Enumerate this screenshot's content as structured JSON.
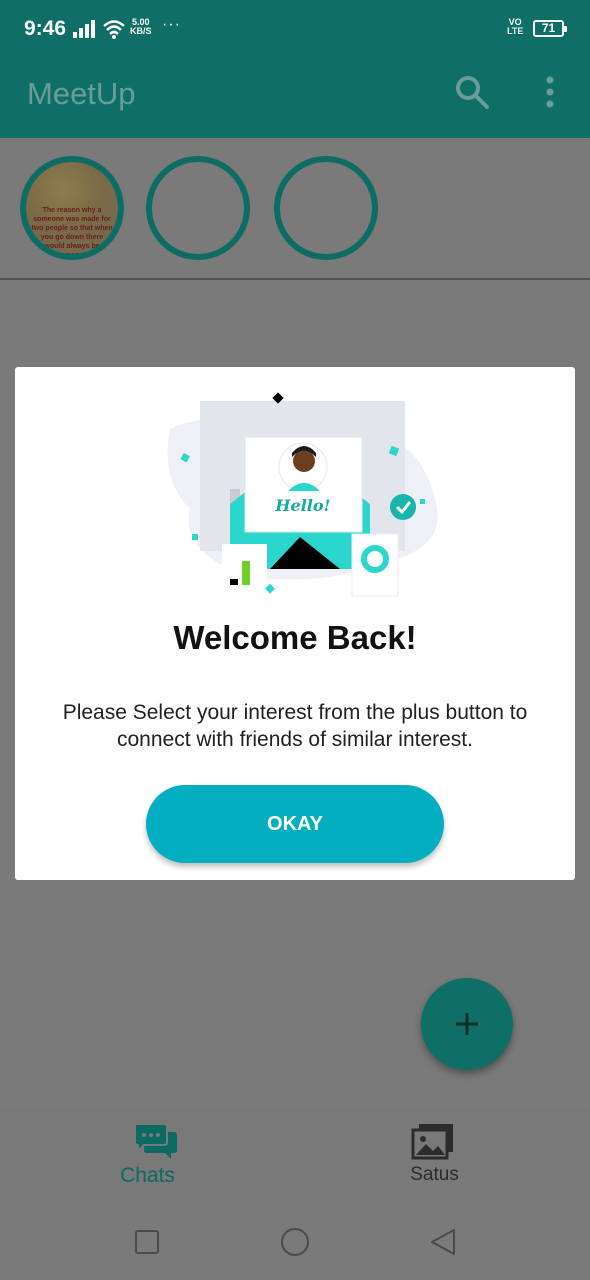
{
  "status_bar": {
    "time": "9:46",
    "net_speed_value": "5.00",
    "net_speed_unit": "KB/S",
    "more": "···",
    "volte_top": "VO",
    "volte_bottom": "LTE",
    "battery": "71"
  },
  "app_bar": {
    "title": "MeetUp",
    "search_icon": "search-icon",
    "menu_icon": "more-vertical-icon"
  },
  "stories": [
    {
      "thumb_text": "The reason why a someone was made for two people so that when you go down there would always be someone"
    },
    {},
    {}
  ],
  "dialog": {
    "title": "Welcome Back!",
    "message": "Please Select your interest from the plus button to connect with friends of similar interest.",
    "button_label": "OKAY",
    "illustration_text": "Hello!"
  },
  "fab": {
    "icon": "plus-icon"
  },
  "bottom_nav": {
    "items": [
      {
        "label": "Chats",
        "icon": "chat-bubbles-icon",
        "active": true
      },
      {
        "label": "Satus",
        "icon": "gallery-icon",
        "active": false
      }
    ]
  },
  "system_nav": {
    "recent_icon": "square-icon",
    "home_icon": "circle-icon",
    "back_icon": "triangle-back-icon"
  },
  "colors": {
    "primary": "#0f6f67",
    "accent_button": "#02aebf",
    "overlay_gray": "#7a7a7a"
  }
}
